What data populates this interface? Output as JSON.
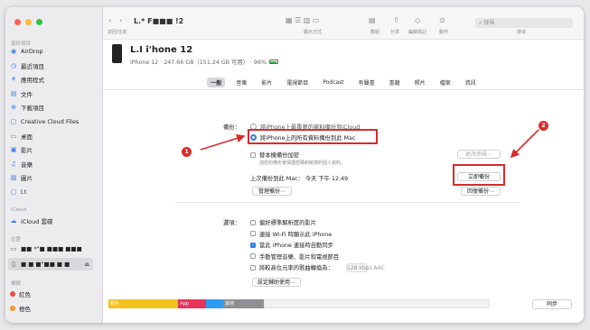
{
  "sidebar": {
    "section_fav": "喜好項目",
    "favorites": [
      {
        "label": "AirDrop",
        "icon": "airdrop-icon"
      },
      {
        "label": "最近項目",
        "icon": "clock-icon"
      },
      {
        "label": "應用程式",
        "icon": "apps-icon"
      },
      {
        "label": "文件",
        "icon": "document-icon"
      },
      {
        "label": "下載項目",
        "icon": "download-icon"
      },
      {
        "label": "Creative Cloud Files",
        "icon": "folder-icon"
      },
      {
        "label": "桌面",
        "icon": "desktop-icon"
      },
      {
        "label": "影片",
        "icon": "film-icon"
      },
      {
        "label": "音樂",
        "icon": "music-icon"
      },
      {
        "label": "圖片",
        "icon": "photo-icon"
      },
      {
        "label": "l.t",
        "icon": "folder-icon"
      }
    ],
    "section_icloud": "iCloud",
    "icloud_drive": "iCloud 雲碟",
    "section_loc": "位置",
    "loc1": "■■ *\"■ ■■■ ■■■",
    "loc2": "■ ■ ■\"■■ ■ ■",
    "section_tag": "標籤",
    "tags": [
      {
        "label": "紅色",
        "color": "#e84d3d"
      },
      {
        "label": "橙色",
        "color": "#f19b2c"
      }
    ]
  },
  "toolbar": {
    "title": "L.* F■■■ !2",
    "back_forward": "返回/往前",
    "view_mode": "顯示方式",
    "group": "群組",
    "share": "分享",
    "tags": "編輯標記",
    "action": "動作",
    "search_placeholder": "搜尋",
    "search_label": "搜尋"
  },
  "device": {
    "name": "L.I i'hone 12",
    "subtitle": "iPhone 12 · 247.66 GB（151.24 GB 可用） · 96%"
  },
  "tabs": [
    "一般",
    "音樂",
    "影片",
    "電視節目",
    "Podcast",
    "有聲書",
    "書籍",
    "照片",
    "檔案",
    "資訊"
  ],
  "backup": {
    "label": "備份：",
    "option1": "將iPhone上最重要的資料備份到iCloud",
    "option2": "將iPhone上的所有資料備份到此 Mac",
    "encrypt": "替本機備份加密",
    "encrypt_desc": "加密的備份會保護密碼和敏感的個人資料。",
    "change_pw": "更改密碼⋯",
    "last_backup": "上次備份到此 Mac：  今天 下午 12:49",
    "backup_now": "立即備份",
    "manage": "管理備份⋯",
    "restore": "回復備份⋯"
  },
  "options": {
    "label": "選項：",
    "items": [
      {
        "label": "偏好標準解析度的影片",
        "checked": false
      },
      {
        "label": "連接 Wi-Fi 時顯示此 iPhone",
        "checked": false
      },
      {
        "label": "當此 iPhone 連接時自動同步",
        "checked": true
      },
      {
        "label": "手動管理音樂、影片和電視節目",
        "checked": false
      },
      {
        "label": "將較高位元率的歌曲轉換為：",
        "checked": false
      }
    ],
    "bitrate": "128 kbps AAC",
    "accessibility": "設定輔助使用⋯"
  },
  "storage": [
    {
      "label": "照片",
      "color": "#f3c21c",
      "fraction": 0.183
    },
    {
      "label": "App",
      "color": "#e8325a",
      "fraction": 0.073
    },
    {
      "label": "",
      "color": "#2b9cf0",
      "fraction": 0.045
    },
    {
      "label": "其他",
      "color": "#8e8e93",
      "fraction": 0.106
    }
  ],
  "sync": "同步",
  "markers": [
    "1",
    "2"
  ]
}
